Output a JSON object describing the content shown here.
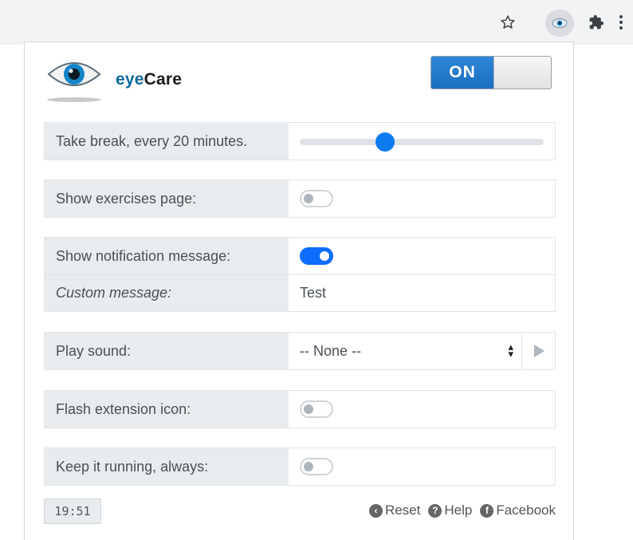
{
  "browser": {
    "icons": {
      "star": "star-icon",
      "extension": "eye-icon",
      "puzzle": "puzzle-icon",
      "menu": "more-vertical-icon"
    }
  },
  "app": {
    "name_prefix": "eye",
    "name_suffix": "Care"
  },
  "master_toggle": {
    "label": "ON",
    "state": true
  },
  "settings": {
    "break": {
      "label": "Take break, every 20 minutes.",
      "slider_fraction": 0.35
    },
    "exercises": {
      "label": "Show exercises page:",
      "enabled": false
    },
    "notification": {
      "label": "Show notification message:",
      "enabled": true
    },
    "custom_message": {
      "label": "Custom message:",
      "value": "Test"
    },
    "sound": {
      "label": "Play sound:",
      "selected": "-- None --"
    },
    "flash": {
      "label": "Flash extension icon:",
      "enabled": false
    },
    "keep_running": {
      "label": "Keep it running, always:",
      "enabled": false
    }
  },
  "footer": {
    "timer": "19:51",
    "links": {
      "reset": "Reset",
      "help": "Help",
      "facebook": "Facebook"
    }
  },
  "colors": {
    "accent": "#0d6efd",
    "brand_blue": "#0b6aa3",
    "label_bg": "#e9ecef"
  }
}
